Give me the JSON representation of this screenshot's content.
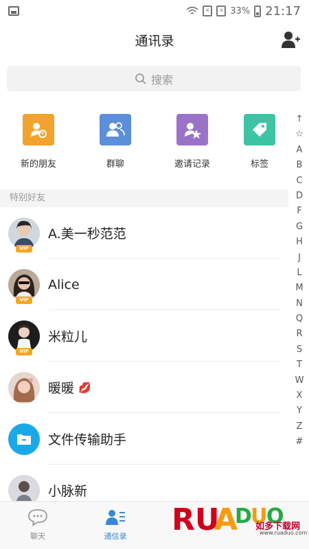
{
  "status_bar": {
    "battery": "33%",
    "time": "21:17"
  },
  "nav": {
    "title": "通讯录"
  },
  "search": {
    "placeholder": "搜索"
  },
  "quick_actions": [
    {
      "label": "新的朋友",
      "color": "#f2a32e",
      "icon": "new-friend-icon"
    },
    {
      "label": "群聊",
      "color": "#5b8fd9",
      "icon": "group-chat-icon"
    },
    {
      "label": "邀请记录",
      "color": "#9a73c9",
      "icon": "invite-record-icon"
    },
    {
      "label": "标签",
      "color": "#3cc4a5",
      "icon": "tag-icon"
    }
  ],
  "section": {
    "title": "特别好友"
  },
  "contacts": [
    {
      "name": "A.美一秒范范",
      "vip": true,
      "vip_label": "VIP"
    },
    {
      "name": "Alice",
      "vip": true,
      "vip_label": "VIP"
    },
    {
      "name": "米粒儿",
      "vip": true,
      "vip_label": "VIP"
    },
    {
      "name": "暖暖",
      "vip": false,
      "emoji": "💋"
    },
    {
      "name": "文件传输助手",
      "vip": false
    },
    {
      "name": "小脉新",
      "vip": false
    }
  ],
  "alpha_index": [
    "↑",
    "☆",
    "A",
    "B",
    "C",
    "D",
    "F",
    "G",
    "H",
    "J",
    "L",
    "M",
    "N",
    "Q",
    "R",
    "S",
    "T",
    "W",
    "X",
    "Y",
    "Z",
    "#"
  ],
  "tabs": [
    {
      "label": "聊天",
      "active": false
    },
    {
      "label": "通信录",
      "active": true
    }
  ],
  "watermark": {
    "chinese": "如多下载网",
    "url": "www.ruaduo.com",
    "logo": "RUADUO"
  },
  "colors": {
    "accent": "#3a87d6",
    "vip": "#f5a623",
    "file_helper": "#1ba8e8"
  }
}
